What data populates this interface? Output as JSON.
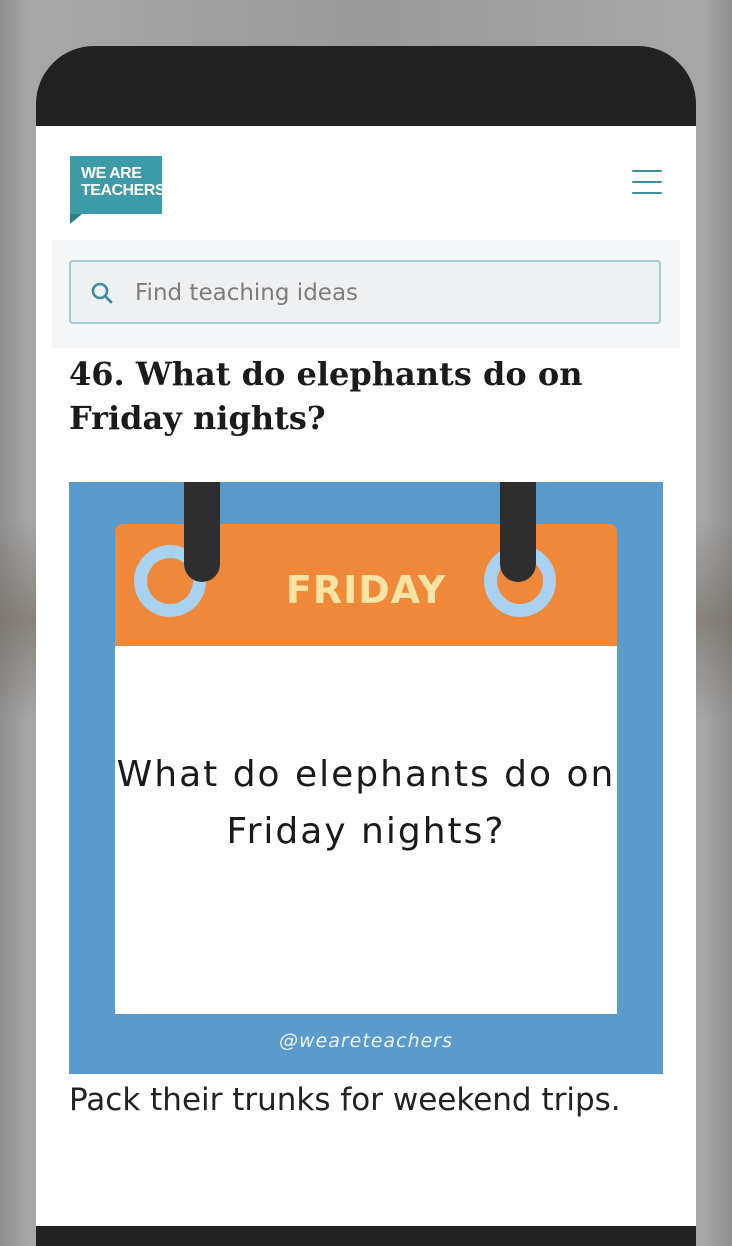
{
  "site": {
    "logo_line1": "WE ARE",
    "logo_line2": "TEACHERS",
    "brand_color": "#3d9aa7"
  },
  "search": {
    "placeholder": "Find teaching ideas",
    "icon": "search-icon"
  },
  "menu": {
    "icon": "hamburger-menu-icon"
  },
  "article": {
    "title": "46. What do elephants do on Friday nights?",
    "graphic": {
      "day_label": "FRIDAY",
      "question": "What do elephants do on Friday nights?",
      "handle": "@weareteachers",
      "colors": {
        "background": "#5b9bcb",
        "header": "#f0883a",
        "rings": "#a9d2f1",
        "label": "#fbe3a4"
      }
    },
    "answer": "Pack their trunks for weekend trips."
  }
}
